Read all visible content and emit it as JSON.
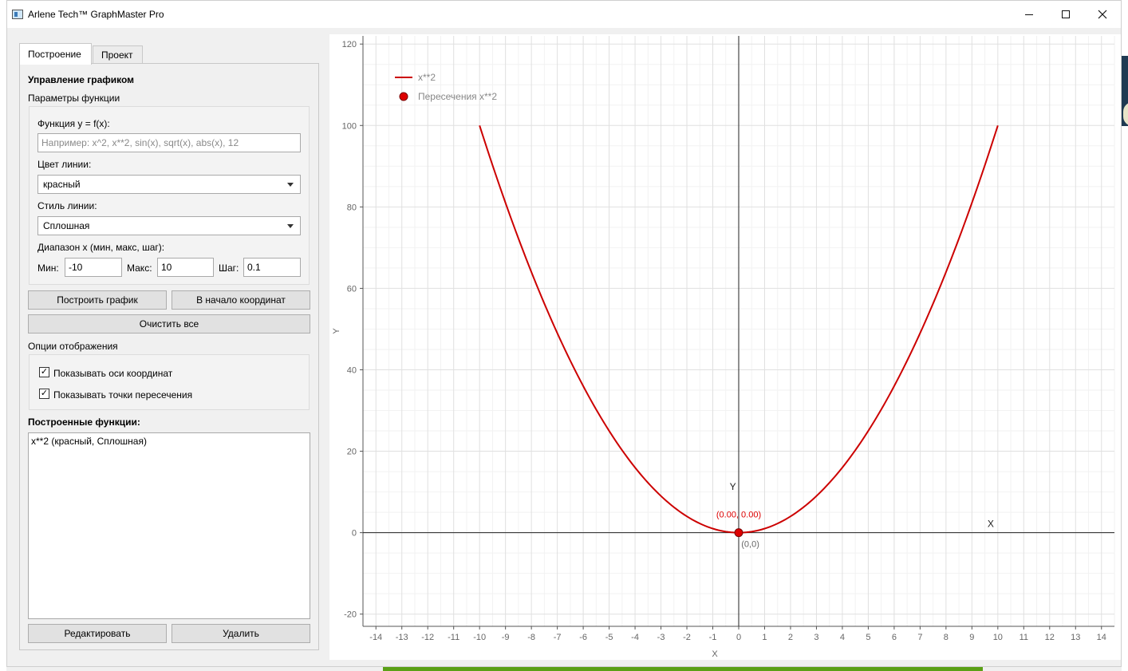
{
  "window": {
    "title": "Arlene Tech™ GraphMaster Pro"
  },
  "tabs": [
    {
      "label": "Построение",
      "active": true
    },
    {
      "label": "Проект",
      "active": false
    }
  ],
  "panel": {
    "heading": "Управление графиком",
    "params_label": "Параметры функции",
    "function_label": "Функция y = f(x):",
    "function_value": "",
    "function_placeholder": "Например: x^2, x**2, sin(x), sqrt(x), abs(x), 12",
    "color_label": "Цвет линии:",
    "color_value": "красный",
    "style_label": "Стиль линии:",
    "style_value": "Сплошная",
    "range_label": "Диапазон x (мин, макс, шаг):",
    "min_label": "Мин:",
    "min_value": "-10",
    "max_label": "Макс:",
    "max_value": "10",
    "step_label": "Шаг:",
    "step_value": "0.1",
    "plot_button": "Построить график",
    "origin_button": "В начало координат",
    "clear_button": "Очистить все",
    "display_options_label": "Опции отображения",
    "show_axes_label": "Показывать оси координат",
    "show_axes_checked": true,
    "show_intersections_label": "Показывать точки пересечения",
    "show_intersections_checked": true,
    "functions_heading": "Построенные функции:",
    "functions_list": [
      "x**2 (красный, Сплошная)"
    ],
    "edit_button": "Редактировать",
    "delete_button": "Удалить"
  },
  "chart_data": {
    "type": "line",
    "xlabel": "X",
    "ylabel": "Y",
    "xlim": [
      -14.5,
      14.5
    ],
    "ylim": [
      -23,
      122
    ],
    "xticks": [
      -14,
      -13,
      -12,
      -11,
      -10,
      -9,
      -8,
      -7,
      -6,
      -5,
      -4,
      -3,
      -2,
      -1,
      0,
      1,
      2,
      3,
      4,
      5,
      6,
      7,
      8,
      9,
      10,
      11,
      12,
      13,
      14
    ],
    "yticks": [
      -20,
      0,
      20,
      40,
      60,
      80,
      100,
      120
    ],
    "grid": true,
    "legend_position": "top-left",
    "axis_labels_on_plot": {
      "x": "X",
      "y": "Y"
    },
    "origin_label": "(0,0)",
    "series": [
      {
        "name": "x**2",
        "color": "#cc0000",
        "style": "solid",
        "x_range": [
          -10,
          10
        ],
        "step": 0.1
      }
    ],
    "points": [
      {
        "name": "Пересечения x**2",
        "x": 0,
        "y": 0,
        "label": "(0.00, 0.00)",
        "color": "#dd0000"
      }
    ],
    "legend": [
      "x**2",
      "Пересечения x**2"
    ]
  },
  "colors": {
    "curve": "#cc0000",
    "point": "#dd0000",
    "axis": "#222222",
    "grid_major": "#e0e0e0",
    "grid_minor": "#f2f2f2"
  }
}
